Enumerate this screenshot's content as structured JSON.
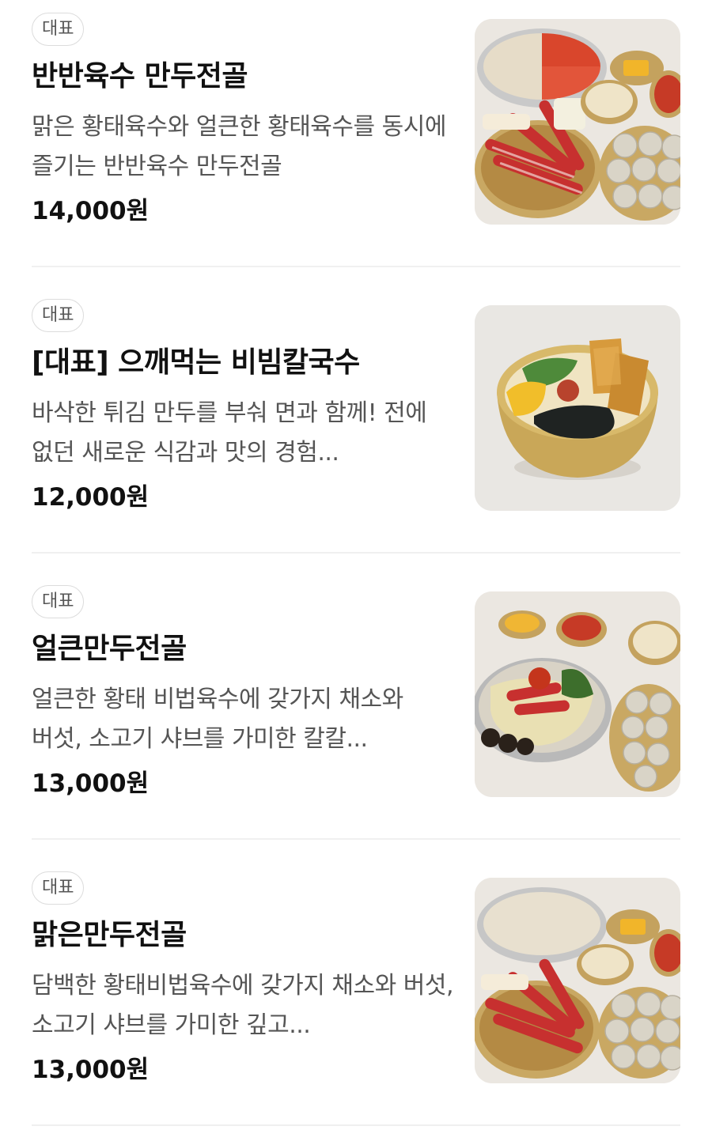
{
  "menu": {
    "items": [
      {
        "badge": "대표",
        "name": "반반육수 만두전골",
        "description": "맑은 황태육수와 얼큰한 황태육수를 동시에 즐기는 반반육수 만두전골",
        "price": "14,000원",
        "image": "half-half-dumpling-hotpot-photo"
      },
      {
        "badge": "대표",
        "name": "[대표] 으깨먹는 비빔칼국수",
        "description": "바삭한 튀김 만두를 부숴 면과 함께! 전에 없던 새로운 식감과 맛의 경험...",
        "price": "12,000원",
        "image": "bibim-kalguksu-photo"
      },
      {
        "badge": "대표",
        "name": "얼큰만두전골",
        "description": "얼큰한 황태 비법육수에 갖가지 채소와 버섯, 소고기 샤브를 가미한 칼칼...",
        "price": "13,000원",
        "image": "spicy-dumpling-hotpot-photo"
      },
      {
        "badge": "대표",
        "name": "맑은만두전골",
        "description": "담백한 황태비법육수에 갖가지 채소와 버섯, 소고기 샤브를 가미한 깊고...",
        "price": "13,000원",
        "image": "clear-dumpling-hotpot-photo"
      }
    ]
  },
  "colors": {
    "text_primary": "#111111",
    "text_secondary": "#555555",
    "badge_border": "#dcdcdc",
    "divider": "#f0f0f0",
    "thumb_bg": "#ece9e4"
  }
}
